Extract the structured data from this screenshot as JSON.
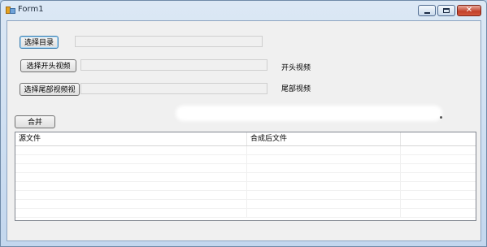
{
  "window": {
    "title": "Form1",
    "caption_buttons": {
      "minimize": "minimize",
      "maximize": "maximize",
      "close": "close"
    }
  },
  "form": {
    "select_dir_button": "选择目录",
    "select_dir_value": "",
    "select_head_button": "选择开头视频",
    "select_head_value": "",
    "head_label": "开头视频",
    "select_tail_button": "选择尾部视频视",
    "select_tail_value": "",
    "tail_label": "尾部视频",
    "merge_button": "合并"
  },
  "grid": {
    "columns": [
      "源文件",
      "合成后文件",
      ""
    ],
    "rows": [
      [
        "",
        "",
        ""
      ],
      [
        "",
        "",
        ""
      ],
      [
        "",
        "",
        ""
      ],
      [
        "",
        "",
        ""
      ],
      [
        "",
        "",
        ""
      ],
      [
        "",
        "",
        ""
      ],
      [
        "",
        "",
        ""
      ],
      [
        "",
        "",
        ""
      ]
    ]
  },
  "colors": {
    "title_gradient_top": "#dce8f5",
    "client_bg": "#f0f0f0",
    "close_button": "#c2402a"
  }
}
